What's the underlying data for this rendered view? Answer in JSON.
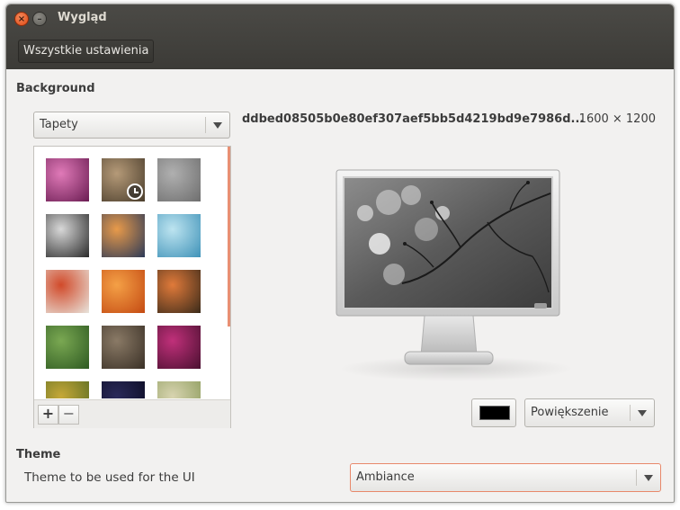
{
  "window": {
    "title": "Wygląd",
    "close_glyph": "×",
    "minimize_glyph": "–",
    "all_settings_label": "Wszystkie ustawienia"
  },
  "background": {
    "section_title": "Background",
    "source_select": "Tapety",
    "filename": "ddbed08505b0e80ef307aef5bb5d4219bd9e7986d...",
    "resolution": "1600 × 1200",
    "add_label": "+",
    "remove_label": "−",
    "color": "#000000",
    "scale_select": "Powiększenie",
    "selected_thumbnail_index": 1,
    "thumbnails": [
      {
        "name": "pink-bokeh",
        "colors": [
          "#e07ab8",
          "#6a1c52"
        ]
      },
      {
        "name": "fountain-pen-sepia",
        "colors": [
          "#b59a78",
          "#4a3d2c"
        ]
      },
      {
        "name": "foggy-deer",
        "colors": [
          "#b0b0b0",
          "#6e6e6e"
        ]
      },
      {
        "name": "monochrome-bikes",
        "colors": [
          "#d8d8d8",
          "#2a2a2a"
        ]
      },
      {
        "name": "sunset-road",
        "colors": [
          "#e89a4a",
          "#2c3a58"
        ]
      },
      {
        "name": "blue-ice",
        "colors": [
          "#bde4f0",
          "#3f92b8"
        ]
      },
      {
        "name": "autumn-alley",
        "colors": [
          "#d14a2a",
          "#e8e4dc"
        ]
      },
      {
        "name": "orange-leaves",
        "colors": [
          "#f4a046",
          "#c44a12"
        ]
      },
      {
        "name": "mountain-sunset",
        "colors": [
          "#e07a3a",
          "#3a2a1a"
        ]
      },
      {
        "name": "green-flowers",
        "colors": [
          "#7aa852",
          "#2e5a22"
        ]
      },
      {
        "name": "fountain-pen-dark",
        "colors": [
          "#8a7a66",
          "#3a3026"
        ]
      },
      {
        "name": "pink-flower",
        "colors": [
          "#c0307a",
          "#4a1030"
        ]
      },
      {
        "name": "yellow-flowers",
        "colors": [
          "#c6a838",
          "#556a22"
        ]
      },
      {
        "name": "night-sky",
        "colors": [
          "#2a2a5a",
          "#0a0a20"
        ]
      },
      {
        "name": "meadow",
        "colors": [
          "#d8d4b0",
          "#8a9a5a"
        ]
      }
    ]
  },
  "theme": {
    "section_title": "Theme",
    "label": "Theme to be used for the UI",
    "value": "Ambiance"
  },
  "icons": {
    "close": "close-icon",
    "minimize": "minimize-icon",
    "dropdown": "chevron-down-icon",
    "selected": "clock-icon"
  }
}
